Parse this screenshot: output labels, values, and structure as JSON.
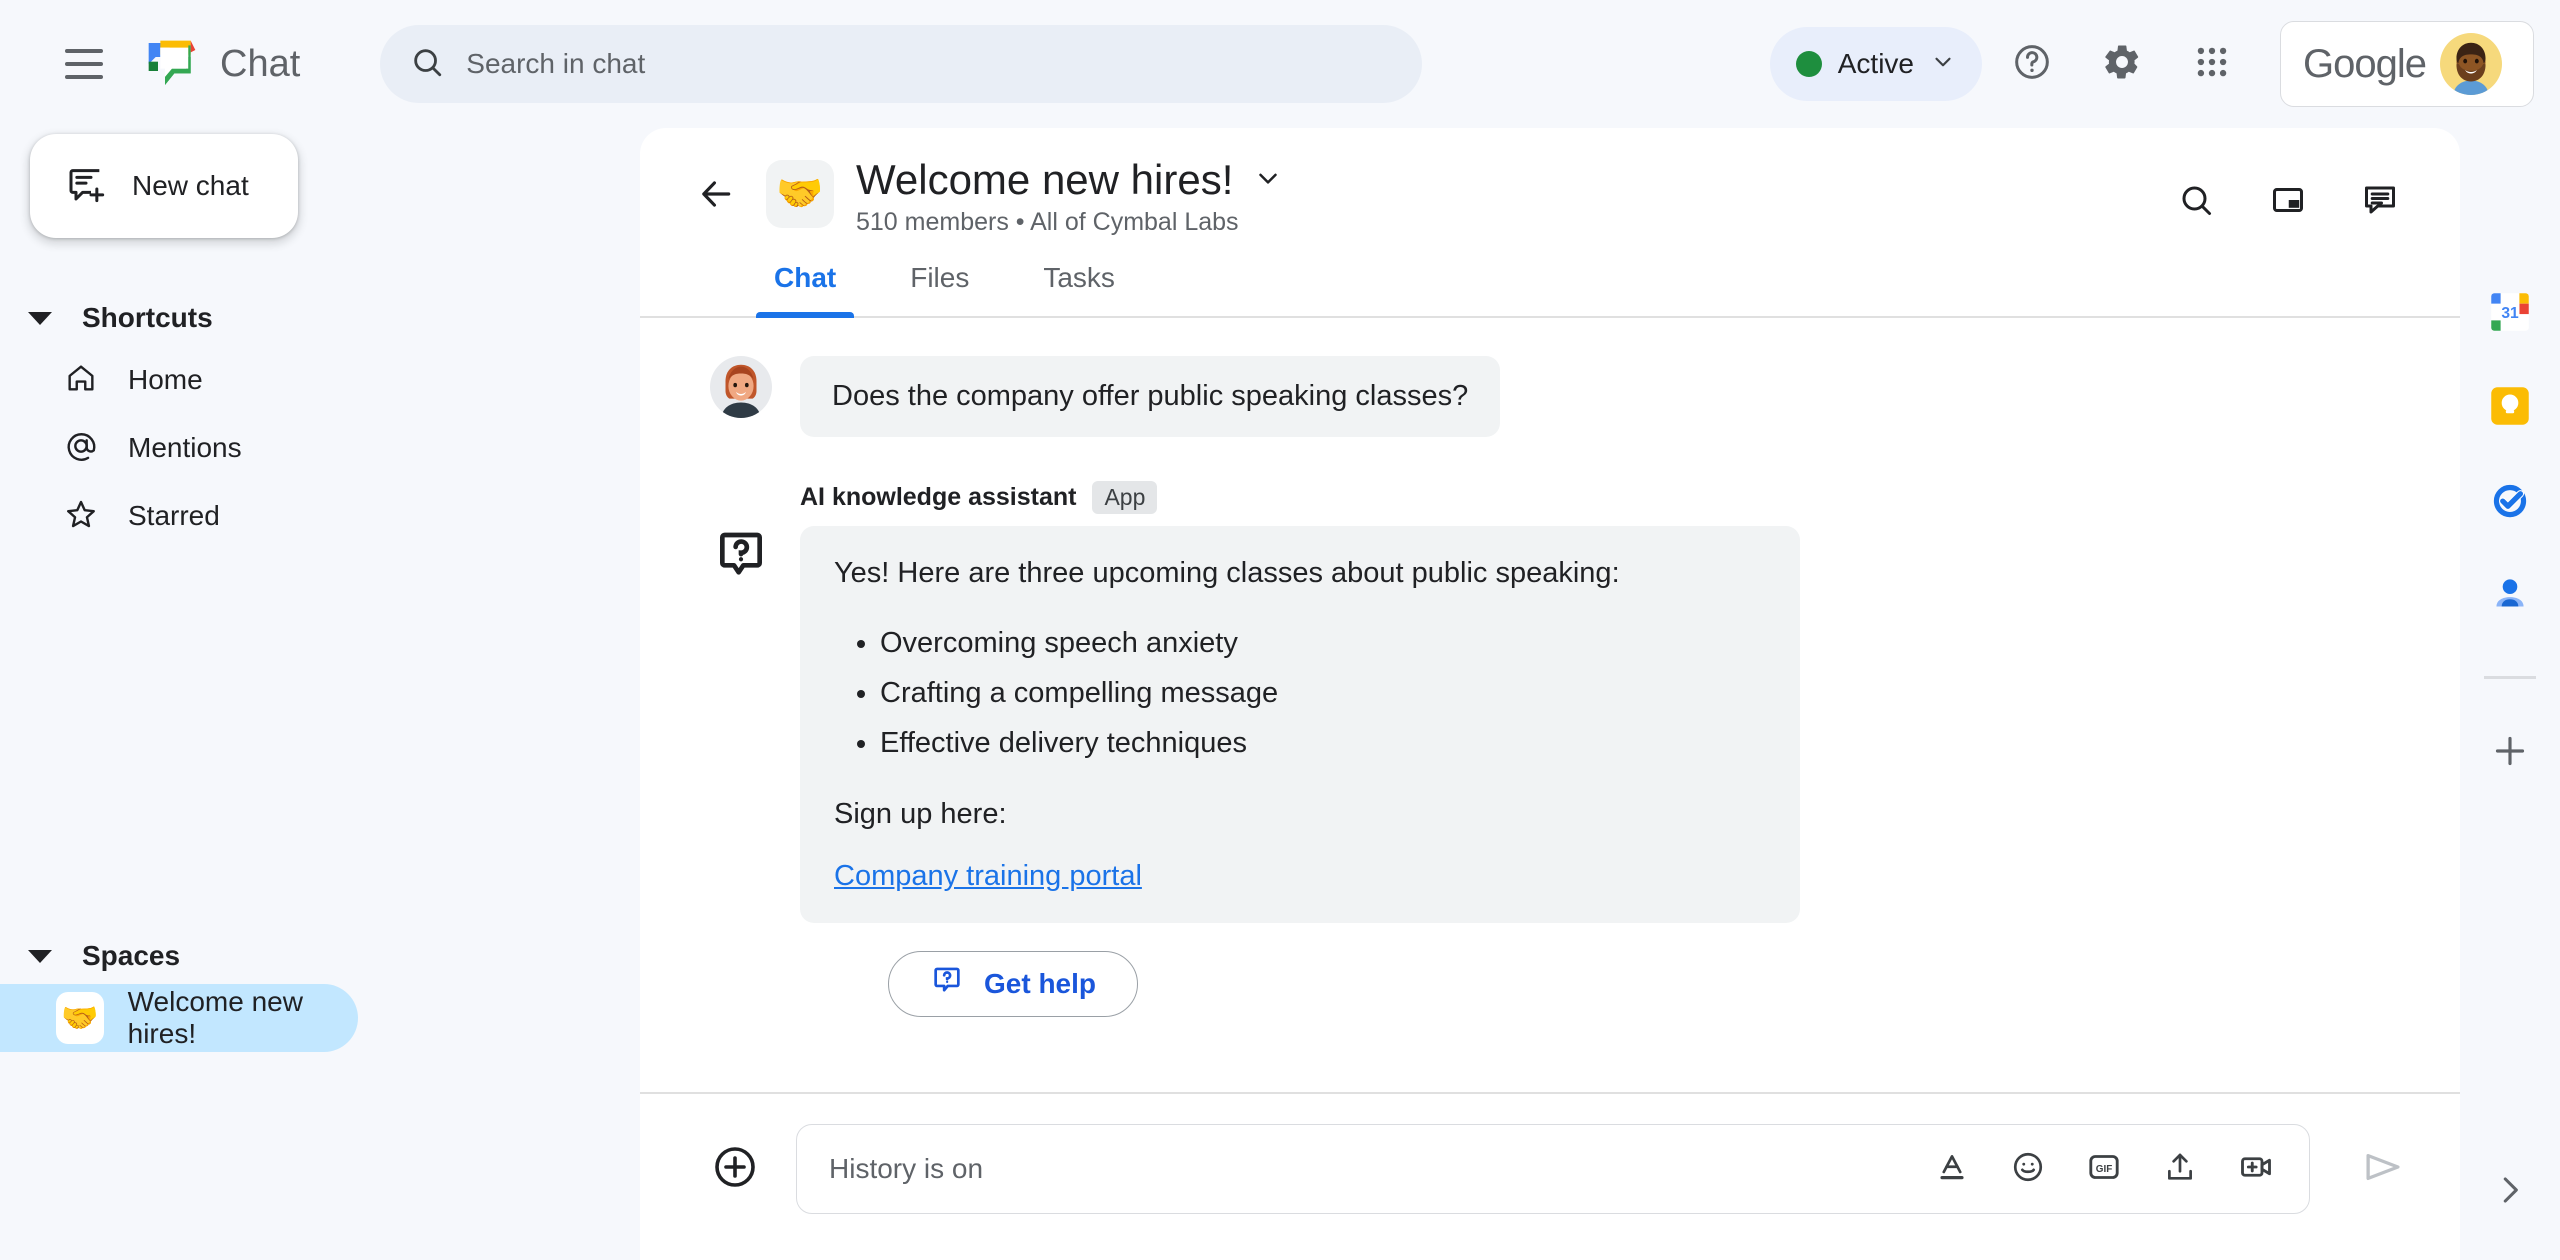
{
  "app": {
    "brand_name": "Chat",
    "brand_logo_icon": "google-chat-logo",
    "menu_icon": "hamburger-menu-icon"
  },
  "search": {
    "placeholder": "Search in chat",
    "icon": "search-icon"
  },
  "topbar": {
    "status_label": "Active",
    "status_color": "#1e8e3e",
    "status_chevron_icon": "chevron-down-icon",
    "help_icon": "help-circle-icon",
    "settings_icon": "gear-icon",
    "apps_icon": "apps-grid-icon",
    "google_wordmark": "Google",
    "avatar_icon": "user-avatar"
  },
  "sidebar": {
    "new_chat_label": "New chat",
    "new_chat_icon": "new-chat-icon",
    "shortcuts": {
      "title": "Shortcuts",
      "items": [
        {
          "label": "Home",
          "icon": "home-icon"
        },
        {
          "label": "Mentions",
          "icon": "at-mention-icon"
        },
        {
          "label": "Starred",
          "icon": "star-icon"
        }
      ]
    },
    "spaces": {
      "title": "Spaces",
      "items": [
        {
          "label": "Welcome new hires!",
          "emoji": "🤝",
          "selected": true
        }
      ]
    }
  },
  "space_header": {
    "back_icon": "arrow-left-icon",
    "emoji": "🤝",
    "title": "Welcome new hires!",
    "title_chevron_icon": "chevron-down-icon",
    "members": "510 members",
    "separator": "•",
    "org": "All of Cymbal Labs",
    "subtitle": "510 members  •  All of Cymbal Labs",
    "actions": [
      {
        "icon": "search-icon",
        "name": "search-in-space-button"
      },
      {
        "icon": "picture-in-picture-icon",
        "name": "picture-in-picture-button"
      },
      {
        "icon": "conversation-toggle-icon",
        "name": "conversation-toggle-button"
      }
    ]
  },
  "tabs": [
    {
      "label": "Chat",
      "active": true
    },
    {
      "label": "Files",
      "active": false
    },
    {
      "label": "Tasks",
      "active": false
    }
  ],
  "conversation": {
    "user_message": {
      "text": "Does the company offer public speaking classes?",
      "avatar_icon": "user-avatar-woman"
    },
    "app_message": {
      "app_name": "AI knowledge assistant",
      "app_badge": "App",
      "app_icon": "question-bubble-icon",
      "intro": "Yes! Here are three upcoming classes about public speaking:",
      "bullets": [
        "Overcoming speech anxiety",
        "Crafting a compelling message",
        "Effective delivery techniques"
      ],
      "signup_text": "Sign up here:",
      "link_text": "Company training portal",
      "link_color": "#1a73e8"
    },
    "get_help_button": {
      "label": "Get help",
      "icon": "question-bubble-icon"
    }
  },
  "composer": {
    "plus_icon": "plus-circle-icon",
    "placeholder": "History is on",
    "icons": [
      {
        "icon": "format-text-icon",
        "name": "format-button"
      },
      {
        "icon": "emoji-icon",
        "name": "emoji-button"
      },
      {
        "icon": "gif-icon",
        "name": "gif-button",
        "label": "GIF"
      },
      {
        "icon": "upload-icon",
        "name": "upload-file-button"
      },
      {
        "icon": "add-video-icon",
        "name": "add-video-meeting-button"
      }
    ],
    "send_icon": "send-icon"
  },
  "right_rail": {
    "items": [
      {
        "icon": "google-calendar-icon",
        "name": "calendar",
        "label": "31"
      },
      {
        "icon": "google-keep-icon",
        "name": "keep"
      },
      {
        "icon": "google-tasks-icon",
        "name": "tasks"
      },
      {
        "icon": "google-contacts-icon",
        "name": "contacts"
      }
    ],
    "add_icon": "plus-icon",
    "expand_icon": "chevron-right-icon"
  }
}
